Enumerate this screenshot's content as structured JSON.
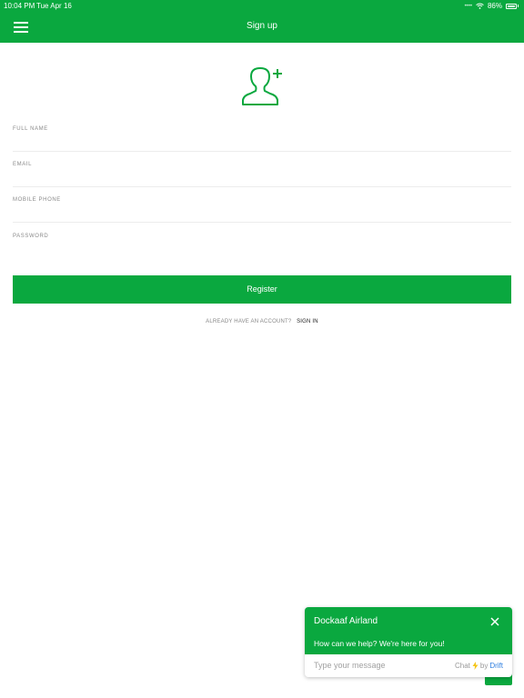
{
  "status_bar": {
    "time": "10:04 PM",
    "date": "Tue Apr 16",
    "battery": "86%"
  },
  "header": {
    "title": "Sign up"
  },
  "form": {
    "fields": [
      {
        "label": "FULL NAME",
        "value": ""
      },
      {
        "label": "EMAIL",
        "value": ""
      },
      {
        "label": "MOBILE PHONE",
        "value": ""
      },
      {
        "label": "PASSWORD",
        "value": ""
      }
    ],
    "register_label": "Register"
  },
  "signin": {
    "question": "ALREADY HAVE AN ACCOUNT?",
    "link": "SIGN IN"
  },
  "chat": {
    "company": "Dockaaf Airland",
    "greeting": "How can we help? We're here for you!",
    "placeholder": "Type your message",
    "brand_prefix": "Chat",
    "brand_by": "by",
    "brand_name": "Drift"
  },
  "colors": {
    "accent": "#0aa83f",
    "link": "#2f7fe0"
  },
  "icons": [
    "menu-icon",
    "add-user-icon",
    "wifi-icon",
    "battery-icon",
    "close-icon",
    "bolt-icon"
  ]
}
